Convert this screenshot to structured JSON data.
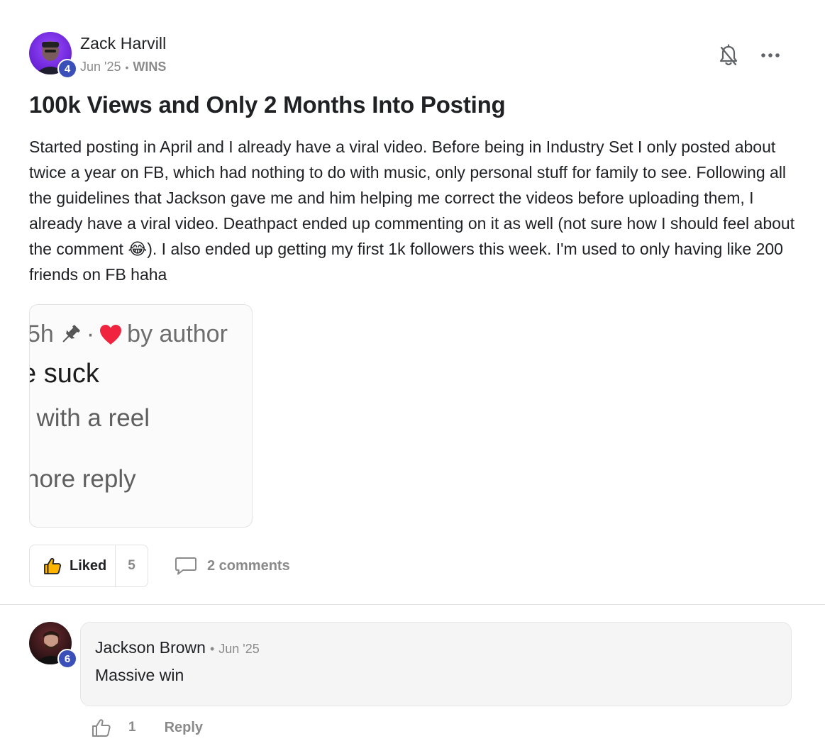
{
  "post": {
    "author": {
      "name": "Zack Harvill",
      "level": "4"
    },
    "date": "Jun '25",
    "separator": "•",
    "category": "WINS",
    "title": "100k Views and Only 2 Months Into Posting",
    "body_part1": "Started posting in April and I already have a viral video. Before being in Industry Set I only posted about twice a year on FB, which had nothing to do with music, only personal stuff for family to see. Following all the guidelines that Jackson gave me and him helping me correct the videos before uploading them, I already have a viral video. Deathpact ended up commenting on it as well (not sure how I should feel about the comment ",
    "body_emoji": "😂",
    "body_part2": "). I also ended up getting my first 1k followers this week. I'm used to only having like 200 friends on FB haha",
    "attachment": {
      "line1_time": "5h",
      "line1_sep": "·",
      "line1_tail": "by author",
      "line2": "e suck",
      "line3": "/ with a reel",
      "line4": "nore reply"
    },
    "actions": {
      "like_label": "Liked",
      "like_count": "5",
      "comments_label": "2 comments"
    }
  },
  "comment": {
    "author": "Jackson Brown",
    "level": "6",
    "separator": "•",
    "date": "Jun '25",
    "text": "Massive win",
    "like_count": "1",
    "reply_label": "Reply"
  },
  "colors": {
    "accent_badge": "#3b4fb8",
    "heart": "#f0243e",
    "muted_text": "#8a8a8a"
  }
}
